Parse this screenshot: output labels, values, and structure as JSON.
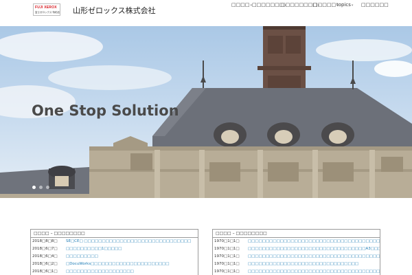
{
  "header": {
    "logo_text": "FUJI XEROX",
    "logo_subtext": "富士ゼロックス 特約店",
    "company_name": "山形ゼロックス株式会社"
  },
  "nav": {
    "items": [
      {
        "label": "□□□□"
      },
      {
        "label": "□□□□□□□"
      },
      {
        "label": "□□□□□□□□"
      },
      {
        "label": "□□□□□"
      },
      {
        "label": "topics"
      },
      {
        "label": "□□□□□□"
      }
    ]
  },
  "hero": {
    "title": "One Stop Solution",
    "slides": 3,
    "active_slide": 1
  },
  "news_left": {
    "heading": "□□□□ – □□□□□□□□",
    "rows": [
      {
        "date": "2018□8□8□",
        "title": "SE□CE□ □□□□□□□□□□□□□□□□□□□□□□□□□□□□□□"
      },
      {
        "date": "2018□6□7□",
        "title": "□□□□□□□□□□1□□□□□"
      },
      {
        "date": "2018□6□4□",
        "title": "□□□□□□□□□"
      },
      {
        "date": "2018□6□2□",
        "title": "□DocuWorks□□□□□□□□□□□□□□□□□□□□□□"
      },
      {
        "date": "2018□6□1□",
        "title": "□□□□□□□□□□□□□□□□□□□"
      }
    ]
  },
  "news_right": {
    "heading": "□□□□ – □□□□□□□□",
    "rows": [
      {
        "date": "1970□1□1□",
        "title": "□□□□□□□□□□□□□□□□□□□□□□□□□□□□□□□□□□□□□□□□□□□□ □□□□□□□□□"
      },
      {
        "date": "1970□1□1□",
        "title": "□□□□□□□□□□□□□□□□□□□□□□□□□□□□□□□□□A3□□□□□□□□□□□□"
      },
      {
        "date": "1970□1□1□",
        "title": "□□□□□□□□□□□□□□□□□□□□□□□□□□□□□□□□□□□□□□□□□"
      },
      {
        "date": "1970□1□1□",
        "title": "□□□□□□□□□□□□□□□□□□□□□□□□□□□□□□□"
      },
      {
        "date": "1970□1□1□",
        "title": "□□□□□□□□□□□□□□□□□□□□□□□□□□□□□□□□□□□□□□□□□□□□□□□"
      }
    ]
  }
}
